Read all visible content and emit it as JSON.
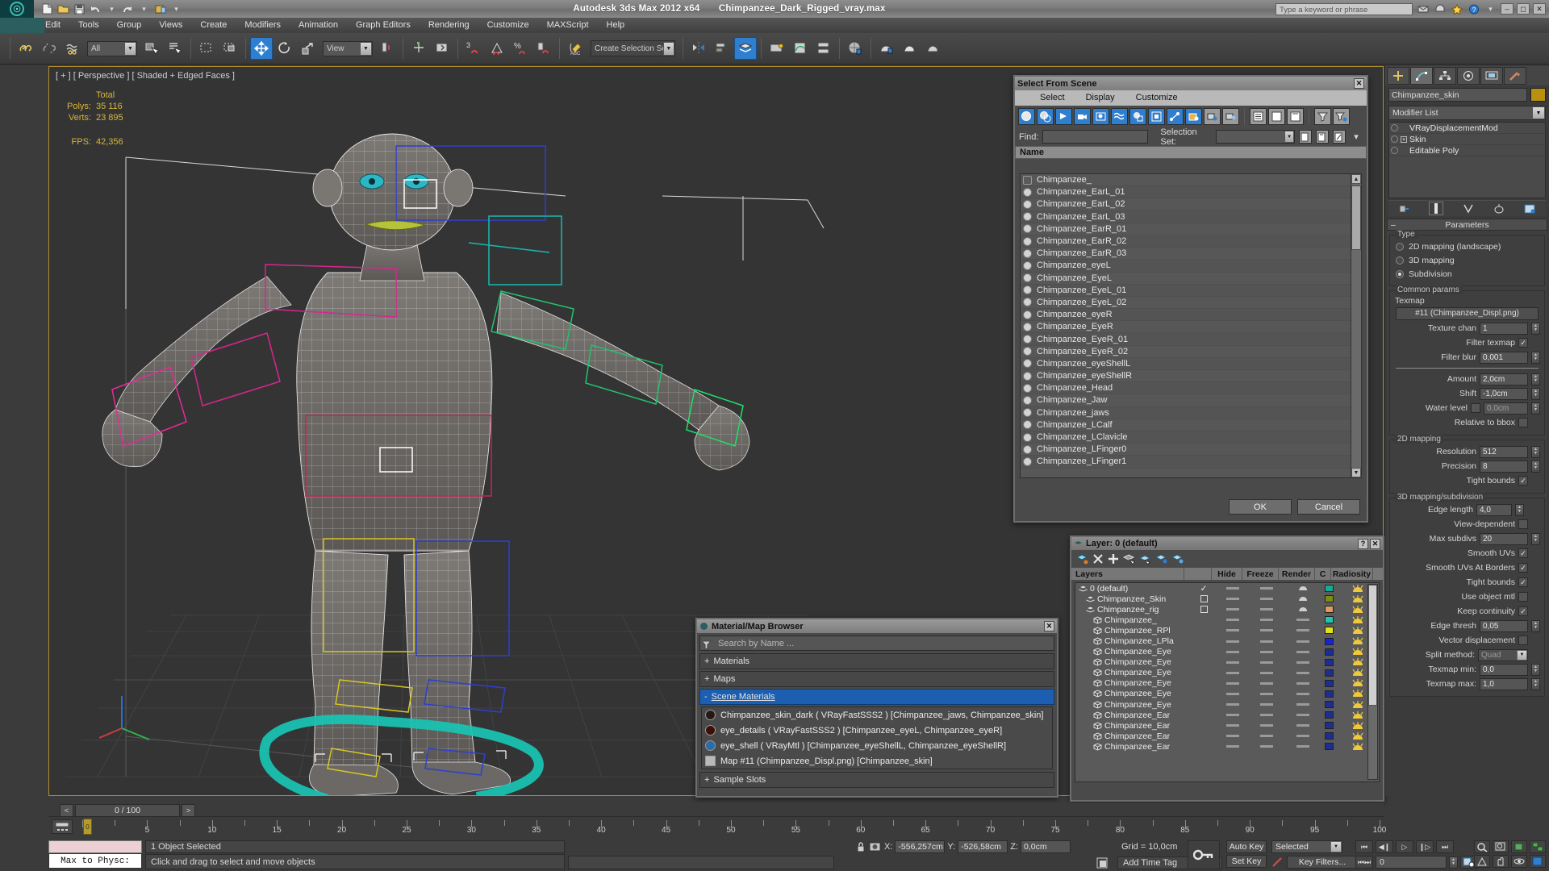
{
  "app": {
    "title": "Autodesk 3ds Max  2012 x64",
    "file": "Chimpanzee_Dark_Rigged_vray.max",
    "search_placeholder": "Type a keyword or phrase"
  },
  "menu": {
    "items": [
      "Edit",
      "Tools",
      "Group",
      "Views",
      "Create",
      "Modifiers",
      "Animation",
      "Graph Editors",
      "Rendering",
      "Customize",
      "MAXScript",
      "Help"
    ]
  },
  "toolbar": {
    "selection_filter": "All",
    "reference_coord": "View",
    "named_selection_set": "Create Selection Se"
  },
  "viewport": {
    "label": "[ + ] [ Perspective ] [ Shaded + Edged Faces ]",
    "stats": {
      "total_header": "Total",
      "polys_label": "Polys:",
      "polys": "35 116",
      "verts_label": "Verts:",
      "verts": "23 895",
      "fps_label": "FPS:",
      "fps": "42,356"
    }
  },
  "select_from_scene": {
    "title": "Select From Scene",
    "menu": [
      "Select",
      "Display",
      "Customize"
    ],
    "find_label": "Find:",
    "find_value": "",
    "selection_set_label": "Selection Set:",
    "selection_set_value": "",
    "column_header": "Name",
    "items": [
      {
        "name": "Chimpanzee_",
        "icon": "box"
      },
      {
        "name": "Chimpanzee_EarL_01",
        "icon": "sphere"
      },
      {
        "name": "Chimpanzee_EarL_02",
        "icon": "sphere"
      },
      {
        "name": "Chimpanzee_EarL_03",
        "icon": "sphere"
      },
      {
        "name": "Chimpanzee_EarR_01",
        "icon": "sphere"
      },
      {
        "name": "Chimpanzee_EarR_02",
        "icon": "sphere"
      },
      {
        "name": "Chimpanzee_EarR_03",
        "icon": "sphere"
      },
      {
        "name": "Chimpanzee_eyeL",
        "icon": "sphere"
      },
      {
        "name": "Chimpanzee_EyeL",
        "icon": "sphere"
      },
      {
        "name": "Chimpanzee_EyeL_01",
        "icon": "sphere"
      },
      {
        "name": "Chimpanzee_EyeL_02",
        "icon": "sphere"
      },
      {
        "name": "Chimpanzee_eyeR",
        "icon": "sphere"
      },
      {
        "name": "Chimpanzee_EyeR",
        "icon": "sphere"
      },
      {
        "name": "Chimpanzee_EyeR_01",
        "icon": "sphere"
      },
      {
        "name": "Chimpanzee_EyeR_02",
        "icon": "sphere"
      },
      {
        "name": "Chimpanzee_eyeShellL",
        "icon": "sphere"
      },
      {
        "name": "Chimpanzee_eyeShellR",
        "icon": "sphere"
      },
      {
        "name": "Chimpanzee_Head",
        "icon": "sphere"
      },
      {
        "name": "Chimpanzee_Jaw",
        "icon": "sphere"
      },
      {
        "name": "Chimpanzee_jaws",
        "icon": "sphere"
      },
      {
        "name": "Chimpanzee_LCalf",
        "icon": "sphere"
      },
      {
        "name": "Chimpanzee_LClavicle",
        "icon": "sphere"
      },
      {
        "name": "Chimpanzee_LFinger0",
        "icon": "sphere"
      },
      {
        "name": "Chimpanzee_LFinger1",
        "icon": "sphere"
      }
    ],
    "ok_label": "OK",
    "cancel_label": "Cancel"
  },
  "layer_window": {
    "title": "Layer: 0 (default)",
    "columns": [
      "Layers",
      "",
      "Hide",
      "Freeze",
      "Render",
      "C",
      "Radiosity"
    ],
    "rows": [
      {
        "name": "0 (default)",
        "indent": 0,
        "type": "layer",
        "current": true,
        "color": "#17a898"
      },
      {
        "name": "Chimpanzee_Skin",
        "indent": 1,
        "type": "layer",
        "current": false,
        "color": "#7d8c12"
      },
      {
        "name": "Chimpanzee_rig",
        "indent": 1,
        "type": "layer",
        "current": false,
        "color": "#e09a5a"
      },
      {
        "name": "Chimpanzee_",
        "indent": 2,
        "type": "object",
        "current": false,
        "color": "#1dc9ae"
      },
      {
        "name": "Chimpanzee_RPl",
        "indent": 2,
        "type": "object",
        "current": false,
        "color": "#e3e318"
      },
      {
        "name": "Chimpanzee_LPla",
        "indent": 2,
        "type": "object",
        "current": false,
        "color": "#1a22d8"
      },
      {
        "name": "Chimpanzee_Eye",
        "indent": 2,
        "type": "object",
        "current": false,
        "color": "#1d2e8f"
      },
      {
        "name": "Chimpanzee_Eye",
        "indent": 2,
        "type": "object",
        "current": false,
        "color": "#1d2e8f"
      },
      {
        "name": "Chimpanzee_Eye",
        "indent": 2,
        "type": "object",
        "current": false,
        "color": "#1d2e8f"
      },
      {
        "name": "Chimpanzee_Eye",
        "indent": 2,
        "type": "object",
        "current": false,
        "color": "#1d2e8f"
      },
      {
        "name": "Chimpanzee_Eye",
        "indent": 2,
        "type": "object",
        "current": false,
        "color": "#1d2e8f"
      },
      {
        "name": "Chimpanzee_Eye",
        "indent": 2,
        "type": "object",
        "current": false,
        "color": "#1d2e8f"
      },
      {
        "name": "Chimpanzee_Ear",
        "indent": 2,
        "type": "object",
        "current": false,
        "color": "#1d2e8f"
      },
      {
        "name": "Chimpanzee_Ear",
        "indent": 2,
        "type": "object",
        "current": false,
        "color": "#1d2e8f"
      },
      {
        "name": "Chimpanzee_Ear",
        "indent": 2,
        "type": "object",
        "current": false,
        "color": "#1d2e8f"
      },
      {
        "name": "Chimpanzee_Ear",
        "indent": 2,
        "type": "object",
        "current": false,
        "color": "#1d2e8f"
      }
    ]
  },
  "material_browser": {
    "title": "Material/Map Browser",
    "search_placeholder": "Search by Name ...",
    "groups": [
      {
        "label": "Materials",
        "state": "+"
      },
      {
        "label": "Maps",
        "state": "+"
      }
    ],
    "scene_materials_label": "Scene Materials",
    "scene_materials_state": "-",
    "materials": [
      {
        "name": "Chimpanzee_skin_dark",
        "type": "( VRayFastSSS2 )",
        "assigned": "[Chimpanzee_jaws, Chimpanzee_skin]",
        "swatch": "#241a14",
        "shape": "circle"
      },
      {
        "name": "eye_details",
        "type": "( VRayFastSSS2 )",
        "assigned": "[Chimpanzee_eyeL, Chimpanzee_eyeR]",
        "swatch": "#3a1008",
        "shape": "circle"
      },
      {
        "name": "eye_shell",
        "type": "( VRayMtl )",
        "assigned": "[Chimpanzee_eyeShellL, Chimpanzee_eyeShellR]",
        "swatch": "#2a6ba8",
        "shape": "circle"
      },
      {
        "name": "Map #11 (Chimpanzee_Displ.png)",
        "type": "",
        "assigned": "[Chimpanzee_skin]",
        "swatch": "#b9b9b9",
        "shape": "square"
      }
    ],
    "sample_slots_label": "Sample Slots",
    "sample_slots_state": "+"
  },
  "command_panel": {
    "object_name": "Chimpanzee_skin",
    "object_color": "#b8920f",
    "modifier_list_label": "Modifier List",
    "modifier_stack": [
      {
        "label": "VRayDisplacementMod",
        "has_sub": false
      },
      {
        "label": "Skin",
        "has_sub": true
      },
      {
        "label": "Editable Poly",
        "has_sub": false
      }
    ],
    "rollup_title": "Parameters",
    "type_group_label": "Type",
    "type_options": [
      {
        "label": "2D mapping (landscape)",
        "selected": false
      },
      {
        "label": "3D mapping",
        "selected": false
      },
      {
        "label": "Subdivision",
        "selected": true
      }
    ],
    "common_params_label": "Common params",
    "texmap_label": "Texmap",
    "texmap_value": "#11 (Chimpanzee_Displ.png)",
    "texture_chan_label": "Texture chan",
    "texture_chan_value": "1",
    "filter_texmap_label": "Filter texmap",
    "filter_texmap_checked": true,
    "filter_blur_label": "Filter blur",
    "filter_blur_value": "0,001",
    "amount_label": "Amount",
    "amount_value": "2,0cm",
    "shift_label": "Shift",
    "shift_value": "-1,0cm",
    "water_level_label": "Water level",
    "water_level_checked": false,
    "water_level_value": "0,0cm",
    "relative_to_bbox_label": "Relative to bbox",
    "relative_to_bbox_checked": false,
    "twod_mapping_label": "2D mapping",
    "resolution_label": "Resolution",
    "resolution_value": "512",
    "precision_label": "Precision",
    "precision_value": "8",
    "tight_bounds_2d_label": "Tight bounds",
    "tight_bounds_2d_checked": true,
    "threed_mapping_label": "3D mapping/subdivision",
    "edge_length_label": "Edge length",
    "edge_length_value": "4,0",
    "view_dependent_label": "View-dependent",
    "view_dependent_checked": false,
    "max_subdivs_label": "Max subdivs",
    "max_subdivs_value": "20",
    "smooth_uvs_label": "Smooth UVs",
    "smooth_uvs_checked": true,
    "smooth_uvs_borders_label": "Smooth UVs At Borders",
    "smooth_uvs_borders_checked": true,
    "tight_bounds_3d_label": "Tight bounds",
    "tight_bounds_3d_checked": true,
    "use_object_mtl_label": "Use object mtl",
    "use_object_mtl_checked": false,
    "keep_continuity_label": "Keep continuity",
    "keep_continuity_checked": true,
    "edge_thresh_label": "Edge thresh",
    "edge_thresh_value": "0,05",
    "vector_displacement_label": "Vector displacement",
    "vector_displacement_checked": false,
    "split_method_label": "Split method:",
    "split_method_value": "Quad",
    "texmap_min_label": "Texmap min:",
    "texmap_min_value": "0,0",
    "texmap_max_label": "Texmap max:",
    "texmap_max_value": "1,0"
  },
  "timeline": {
    "frame_display": "0 / 100",
    "prev_label": "<",
    "next_label": ">",
    "ticks": [
      "5",
      "10",
      "15",
      "20",
      "25",
      "30",
      "35",
      "40",
      "45",
      "50",
      "55",
      "60",
      "65",
      "70",
      "75",
      "80",
      "85",
      "90",
      "95",
      "100"
    ],
    "playhead_label": "0"
  },
  "status_bar": {
    "max_to_physx": "Max to Physc:",
    "objects_selected": "1 Object Selected",
    "prompt": "Click and drag to select and move objects",
    "x_label": "X:",
    "x_value": "-556,257cm",
    "y_label": "Y:",
    "y_value": "-526,58cm",
    "z_label": "Z:",
    "z_value": "0,0cm",
    "grid": "Grid = 10,0cm",
    "add_time_tag": "Add Time Tag",
    "auto_key": "Auto Key",
    "set_key": "Set Key",
    "key_mode": "Selected",
    "key_filters": "Key Filters...",
    "current_frame": "0"
  }
}
